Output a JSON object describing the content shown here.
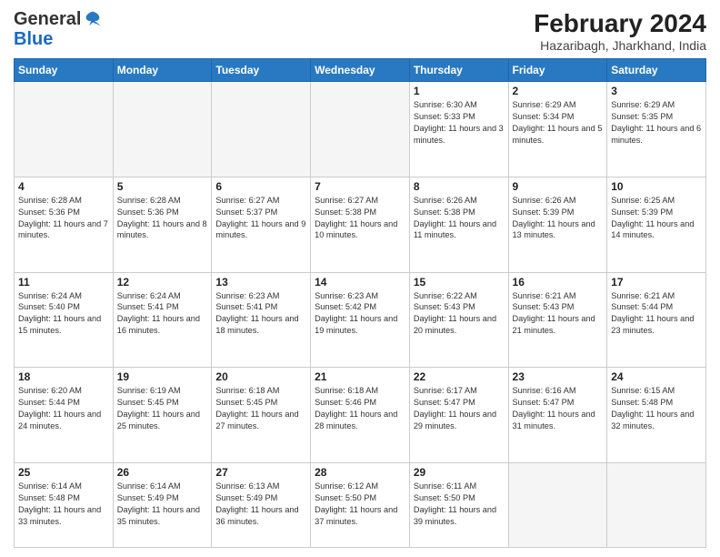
{
  "header": {
    "logo_general": "General",
    "logo_blue": "Blue",
    "month_year": "February 2024",
    "location": "Hazaribagh, Jharkhand, India"
  },
  "days_of_week": [
    "Sunday",
    "Monday",
    "Tuesday",
    "Wednesday",
    "Thursday",
    "Friday",
    "Saturday"
  ],
  "weeks": [
    [
      {
        "day": "",
        "text": ""
      },
      {
        "day": "",
        "text": ""
      },
      {
        "day": "",
        "text": ""
      },
      {
        "day": "",
        "text": ""
      },
      {
        "day": "1",
        "text": "Sunrise: 6:30 AM\nSunset: 5:33 PM\nDaylight: 11 hours and 3 minutes."
      },
      {
        "day": "2",
        "text": "Sunrise: 6:29 AM\nSunset: 5:34 PM\nDaylight: 11 hours and 5 minutes."
      },
      {
        "day": "3",
        "text": "Sunrise: 6:29 AM\nSunset: 5:35 PM\nDaylight: 11 hours and 6 minutes."
      }
    ],
    [
      {
        "day": "4",
        "text": "Sunrise: 6:28 AM\nSunset: 5:36 PM\nDaylight: 11 hours and 7 minutes."
      },
      {
        "day": "5",
        "text": "Sunrise: 6:28 AM\nSunset: 5:36 PM\nDaylight: 11 hours and 8 minutes."
      },
      {
        "day": "6",
        "text": "Sunrise: 6:27 AM\nSunset: 5:37 PM\nDaylight: 11 hours and 9 minutes."
      },
      {
        "day": "7",
        "text": "Sunrise: 6:27 AM\nSunset: 5:38 PM\nDaylight: 11 hours and 10 minutes."
      },
      {
        "day": "8",
        "text": "Sunrise: 6:26 AM\nSunset: 5:38 PM\nDaylight: 11 hours and 11 minutes."
      },
      {
        "day": "9",
        "text": "Sunrise: 6:26 AM\nSunset: 5:39 PM\nDaylight: 11 hours and 13 minutes."
      },
      {
        "day": "10",
        "text": "Sunrise: 6:25 AM\nSunset: 5:39 PM\nDaylight: 11 hours and 14 minutes."
      }
    ],
    [
      {
        "day": "11",
        "text": "Sunrise: 6:24 AM\nSunset: 5:40 PM\nDaylight: 11 hours and 15 minutes."
      },
      {
        "day": "12",
        "text": "Sunrise: 6:24 AM\nSunset: 5:41 PM\nDaylight: 11 hours and 16 minutes."
      },
      {
        "day": "13",
        "text": "Sunrise: 6:23 AM\nSunset: 5:41 PM\nDaylight: 11 hours and 18 minutes."
      },
      {
        "day": "14",
        "text": "Sunrise: 6:23 AM\nSunset: 5:42 PM\nDaylight: 11 hours and 19 minutes."
      },
      {
        "day": "15",
        "text": "Sunrise: 6:22 AM\nSunset: 5:43 PM\nDaylight: 11 hours and 20 minutes."
      },
      {
        "day": "16",
        "text": "Sunrise: 6:21 AM\nSunset: 5:43 PM\nDaylight: 11 hours and 21 minutes."
      },
      {
        "day": "17",
        "text": "Sunrise: 6:21 AM\nSunset: 5:44 PM\nDaylight: 11 hours and 23 minutes."
      }
    ],
    [
      {
        "day": "18",
        "text": "Sunrise: 6:20 AM\nSunset: 5:44 PM\nDaylight: 11 hours and 24 minutes."
      },
      {
        "day": "19",
        "text": "Sunrise: 6:19 AM\nSunset: 5:45 PM\nDaylight: 11 hours and 25 minutes."
      },
      {
        "day": "20",
        "text": "Sunrise: 6:18 AM\nSunset: 5:45 PM\nDaylight: 11 hours and 27 minutes."
      },
      {
        "day": "21",
        "text": "Sunrise: 6:18 AM\nSunset: 5:46 PM\nDaylight: 11 hours and 28 minutes."
      },
      {
        "day": "22",
        "text": "Sunrise: 6:17 AM\nSunset: 5:47 PM\nDaylight: 11 hours and 29 minutes."
      },
      {
        "day": "23",
        "text": "Sunrise: 6:16 AM\nSunset: 5:47 PM\nDaylight: 11 hours and 31 minutes."
      },
      {
        "day": "24",
        "text": "Sunrise: 6:15 AM\nSunset: 5:48 PM\nDaylight: 11 hours and 32 minutes."
      }
    ],
    [
      {
        "day": "25",
        "text": "Sunrise: 6:14 AM\nSunset: 5:48 PM\nDaylight: 11 hours and 33 minutes."
      },
      {
        "day": "26",
        "text": "Sunrise: 6:14 AM\nSunset: 5:49 PM\nDaylight: 11 hours and 35 minutes."
      },
      {
        "day": "27",
        "text": "Sunrise: 6:13 AM\nSunset: 5:49 PM\nDaylight: 11 hours and 36 minutes."
      },
      {
        "day": "28",
        "text": "Sunrise: 6:12 AM\nSunset: 5:50 PM\nDaylight: 11 hours and 37 minutes."
      },
      {
        "day": "29",
        "text": "Sunrise: 6:11 AM\nSunset: 5:50 PM\nDaylight: 11 hours and 39 minutes."
      },
      {
        "day": "",
        "text": ""
      },
      {
        "day": "",
        "text": ""
      }
    ]
  ]
}
